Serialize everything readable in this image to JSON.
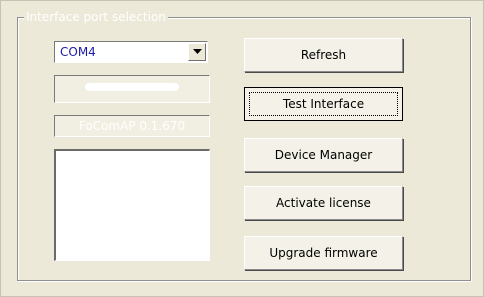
{
  "group": {
    "title": "Interface port selection"
  },
  "port_select": {
    "value": "COM4",
    "arrow_icon": "chevron-down-icon"
  },
  "version": {
    "text": "FoComAP 0.1.670"
  },
  "buttons": {
    "refresh": "Refresh",
    "test_interface": "Test Interface",
    "device_manager": "Device Manager",
    "activate_license": "Activate license",
    "upgrade_firmware": "Upgrade firmware"
  },
  "colors": {
    "window_bg": "#ece9d8",
    "combo_text": "#1a1aa6",
    "disabled_text": "#ffffff"
  }
}
